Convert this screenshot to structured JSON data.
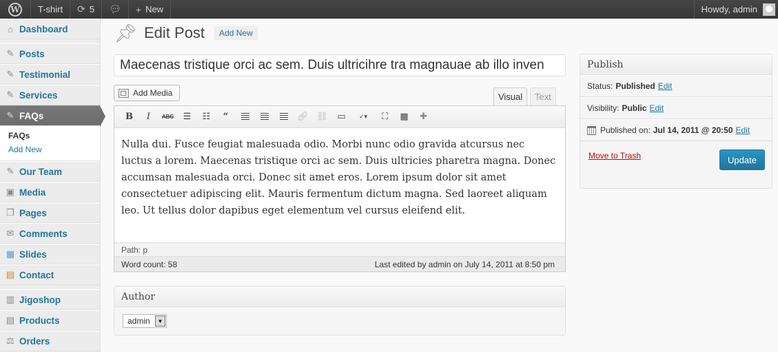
{
  "admin_bar": {
    "site_name": "T-shirt",
    "updates_count": "5",
    "new_label": "New",
    "howdy": "Howdy, admin"
  },
  "sidebar": {
    "items": [
      {
        "label": "Dashboard",
        "icon": "dashboard-icon"
      },
      {
        "label": "Posts",
        "icon": "pin-icon"
      },
      {
        "label": "Testimonial",
        "icon": "pin-icon"
      },
      {
        "label": "Services",
        "icon": "pin-icon"
      },
      {
        "label": "FAQs",
        "icon": "pin-icon",
        "current": true
      },
      {
        "label": "Our Team",
        "icon": "pin-icon"
      },
      {
        "label": "Media",
        "icon": "media-icon"
      },
      {
        "label": "Pages",
        "icon": "pages-icon"
      },
      {
        "label": "Comments",
        "icon": "comments-icon"
      },
      {
        "label": "Slides",
        "icon": "slides-icon"
      },
      {
        "label": "Contact",
        "icon": "contact-icon"
      },
      {
        "label": "Jigoshop",
        "icon": "jigoshop-icon"
      },
      {
        "label": "Products",
        "icon": "products-icon"
      },
      {
        "label": "Orders",
        "icon": "orders-icon"
      }
    ],
    "submenu": [
      "FAQs",
      "Add New"
    ]
  },
  "page": {
    "title": "Edit Post",
    "add_new": "Add New"
  },
  "post": {
    "title": "Maecenas tristique orci ac sem. Duis ultricihre tra magnauae ab illo inven",
    "body": "Nulla dui. Fusce feugiat malesuada odio. Morbi nunc odio gravida atcursus nec luctus a lorem. Maecenas tristique orci ac sem. Duis ultricies pharetra magna. Donec accumsan malesuada orci. Donec sit amet eros. Lorem ipsum dolor sit amet consectetuer adipiscing elit. Mauris fermentum dictum magna. Sed laoreet aliquam leo. Ut tellus dolor dapibus eget elementum vel cursus eleifend elit."
  },
  "editor": {
    "add_media": "Add Media",
    "tab_visual": "Visual",
    "tab_text": "Text",
    "path": "Path: p",
    "word_count": "Word count: 58",
    "last_edited": "Last edited by admin on July 14, 2011 at 8:50 pm"
  },
  "author_box": {
    "title": "Author",
    "selected": "admin"
  },
  "publish_box": {
    "title": "Publish",
    "status_label": "Status:",
    "status_value": "Published",
    "visibility_label": "Visibility:",
    "visibility_value": "Public",
    "published_label": "Published on:",
    "published_value": "Jul 14, 2011 @ 20:50",
    "edit": "Edit",
    "trash": "Move to Trash",
    "update": "Update"
  },
  "colors": {
    "link": "#21759b",
    "admin_bar": "#464646",
    "current_menu": "#6d6d6d",
    "trash": "#bc0b0b",
    "update_button": "#2a95c5"
  }
}
